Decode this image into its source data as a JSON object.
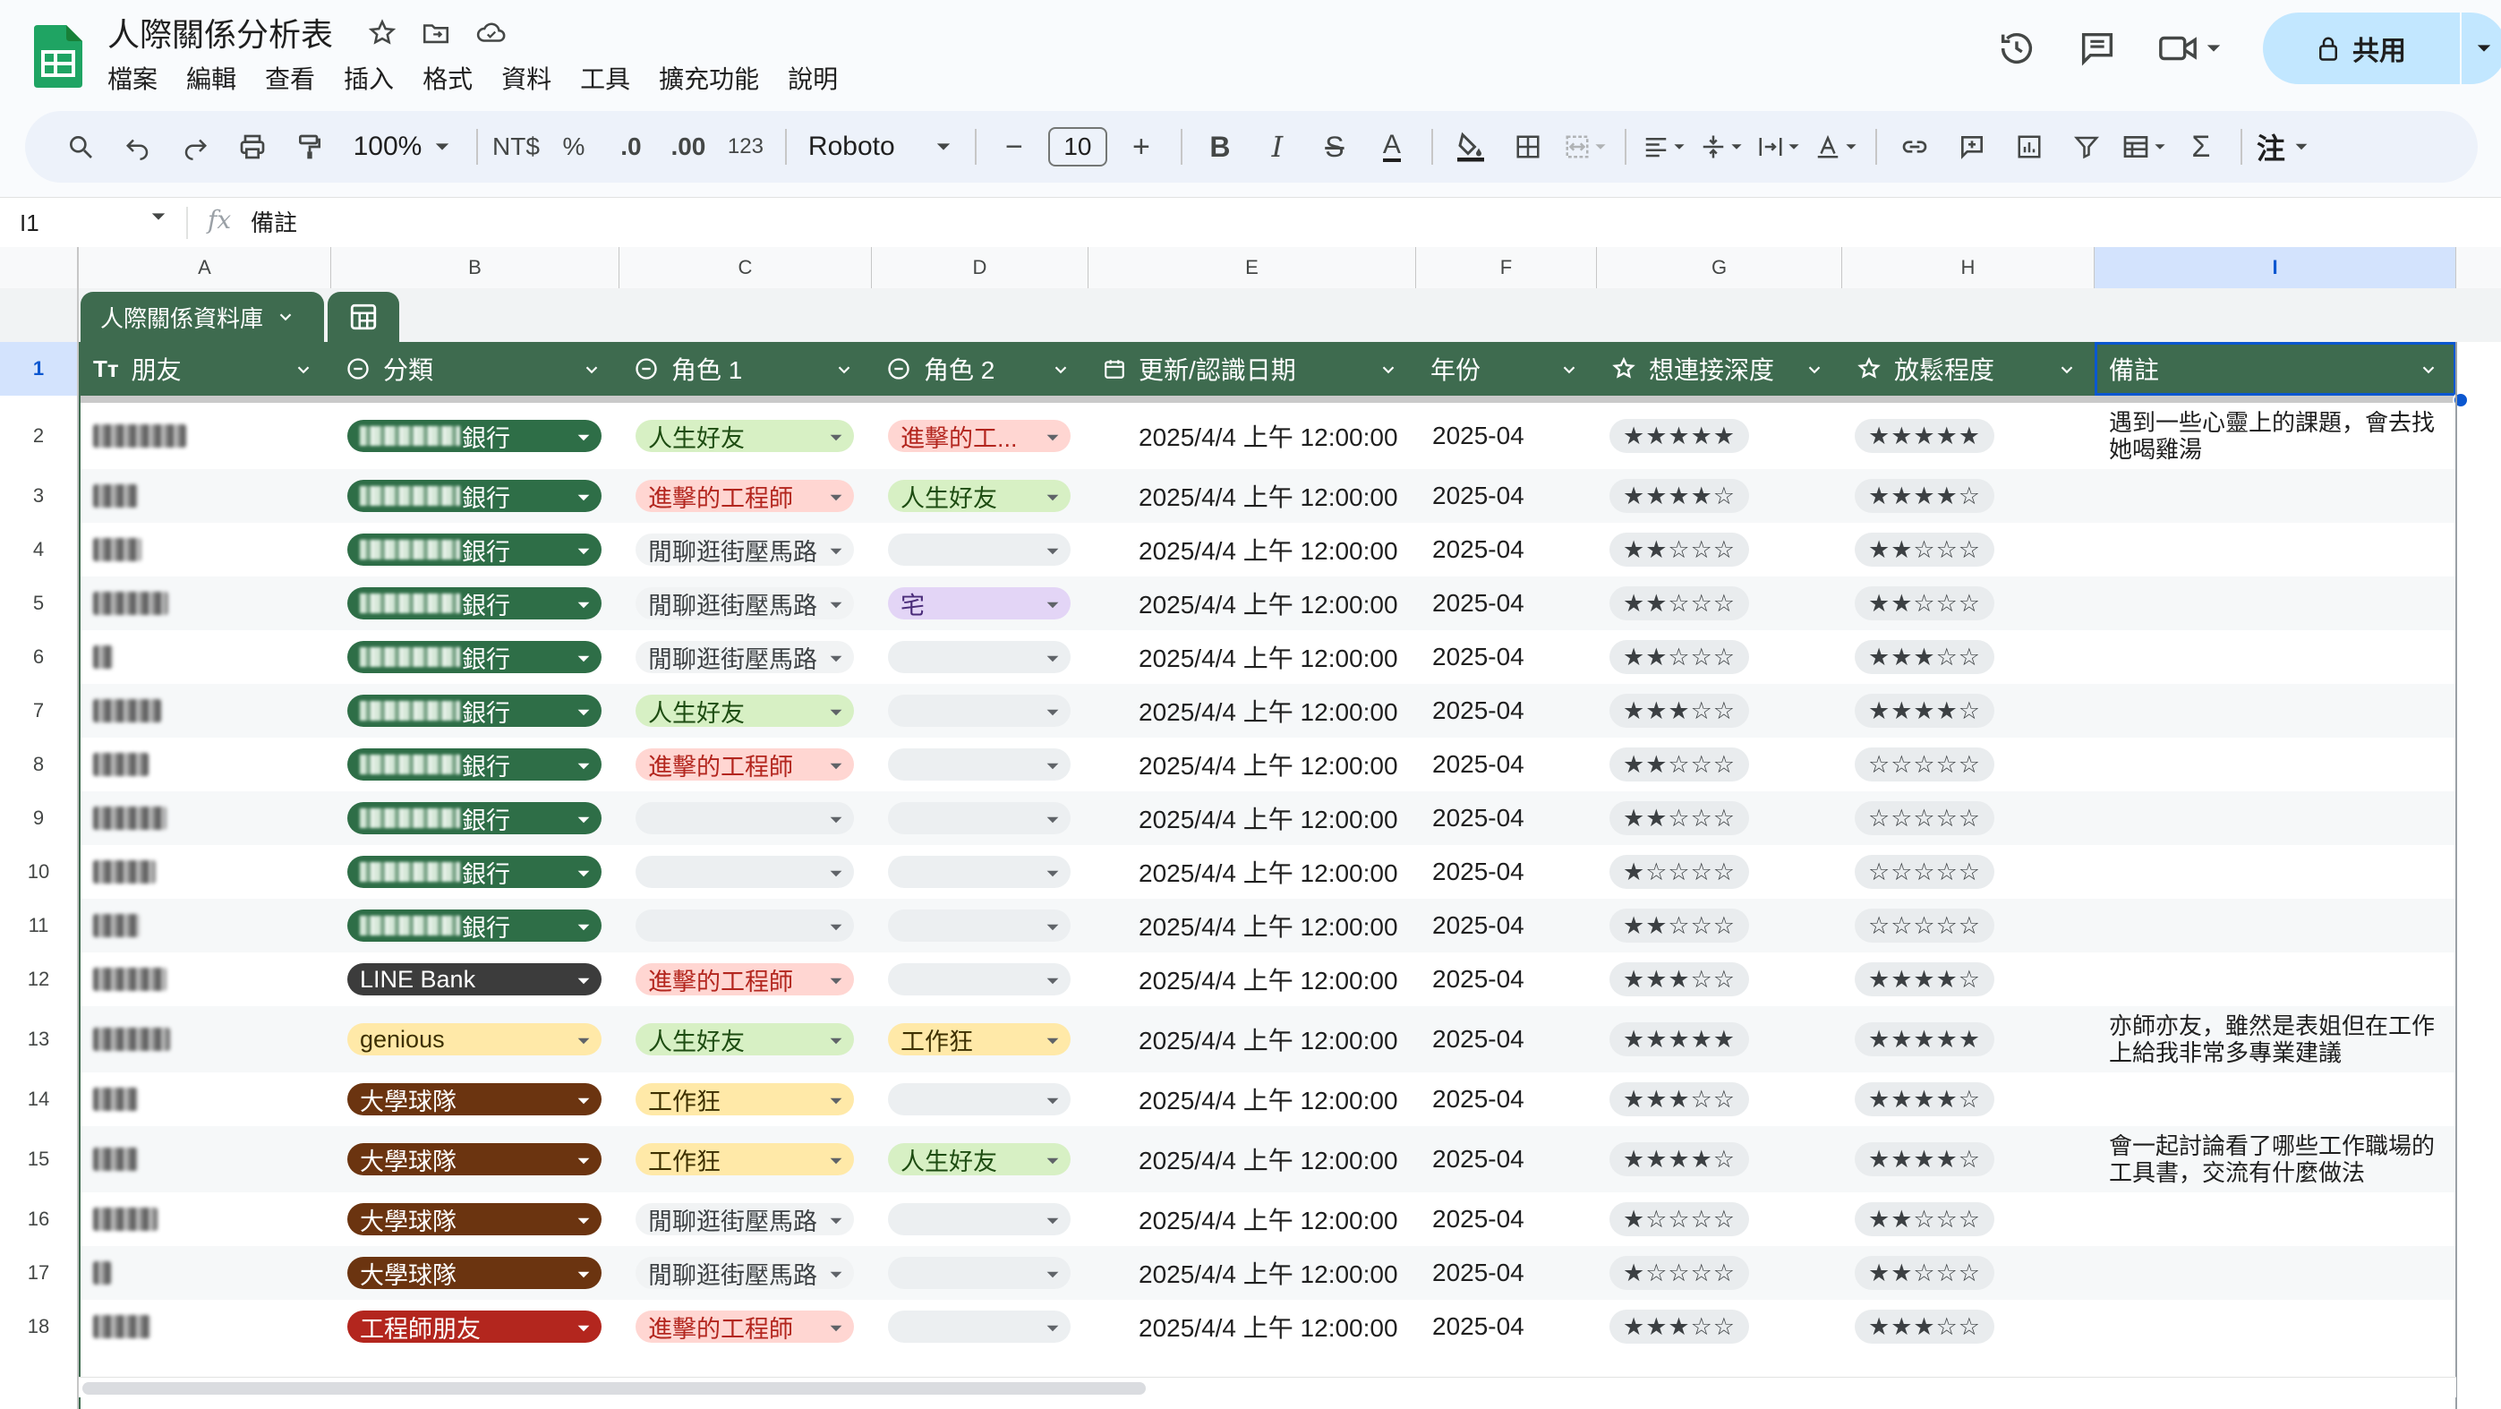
{
  "app": {
    "doc_title": "人際關係分析表",
    "menu": [
      "檔案",
      "編輯",
      "查看",
      "插入",
      "格式",
      "資料",
      "工具",
      "擴充功能",
      "說明"
    ],
    "share_label": "共用"
  },
  "toolbar": {
    "zoom": "100%",
    "currency": "NT$",
    "percent": "%",
    "dec_decrease": ".0",
    "dec_increase": ".00",
    "number_format": "123",
    "font": "Roboto",
    "font_size": "10",
    "minus": "−",
    "plus": "+",
    "bold": "B",
    "italic": "I",
    "strike": "S",
    "text_color": "A",
    "last": "注"
  },
  "formula_bar": {
    "cell_ref": "I1",
    "fx": "fx",
    "value": "備註"
  },
  "columns": [
    "A",
    "B",
    "C",
    "D",
    "E",
    "F",
    "G",
    "H",
    "I"
  ],
  "table": {
    "name": "人際關係資料庫",
    "headers": [
      "朋友",
      "分類",
      "角色 1",
      "角色 2",
      "更新/認識日期",
      "年份",
      "想連接深度",
      "放鬆程度",
      "備註"
    ],
    "header_icons": [
      "text-type-icon",
      "dropdown-chip-icon",
      "dropdown-chip-icon",
      "dropdown-chip-icon",
      "calendar-icon",
      "",
      "star-icon",
      "star-icon",
      ""
    ]
  },
  "rows": [
    {
      "n": "2",
      "cat": "銀行",
      "catColor": "green",
      "r1": "人生好友",
      "r1c": "lime",
      "r2": "進擊的工...",
      "r2c": "red",
      "date": "2025/4/4 上午 12:00:00",
      "year": "2025-04",
      "depth": "★★★★★",
      "relax": "★★★★★",
      "note": "遇到一些心靈上的課題，會去找她喝雞湯"
    },
    {
      "n": "3",
      "cat": "銀行",
      "catColor": "green",
      "r1": "進擊的工程師",
      "r1c": "red",
      "r2": "人生好友",
      "r2c": "lime",
      "date": "2025/4/4 上午 12:00:00",
      "year": "2025-04",
      "depth": "★★★★☆",
      "relax": "★★★★☆",
      "note": ""
    },
    {
      "n": "4",
      "cat": "銀行",
      "catColor": "green",
      "r1": "閒聊逛街壓馬路",
      "r1c": "gray",
      "r2": "",
      "r2c": "empty",
      "date": "2025/4/4 上午 12:00:00",
      "year": "2025-04",
      "depth": "★★☆☆☆",
      "relax": "★★☆☆☆",
      "note": ""
    },
    {
      "n": "5",
      "cat": "銀行",
      "catColor": "green",
      "r1": "閒聊逛街壓馬路",
      "r1c": "gray",
      "r2": "宅",
      "r2c": "purple",
      "date": "2025/4/4 上午 12:00:00",
      "year": "2025-04",
      "depth": "★★☆☆☆",
      "relax": "★★☆☆☆",
      "note": ""
    },
    {
      "n": "6",
      "cat": "銀行",
      "catColor": "green",
      "r1": "閒聊逛街壓馬路",
      "r1c": "gray",
      "r2": "",
      "r2c": "empty",
      "date": "2025/4/4 上午 12:00:00",
      "year": "2025-04",
      "depth": "★★☆☆☆",
      "relax": "★★★☆☆",
      "note": ""
    },
    {
      "n": "7",
      "cat": "銀行",
      "catColor": "green",
      "r1": "人生好友",
      "r1c": "lime",
      "r2": "",
      "r2c": "empty",
      "date": "2025/4/4 上午 12:00:00",
      "year": "2025-04",
      "depth": "★★★☆☆",
      "relax": "★★★★☆",
      "note": ""
    },
    {
      "n": "8",
      "cat": "銀行",
      "catColor": "green",
      "r1": "進擊的工程師",
      "r1c": "red",
      "r2": "",
      "r2c": "empty",
      "date": "2025/4/4 上午 12:00:00",
      "year": "2025-04",
      "depth": "★★☆☆☆",
      "relax": "☆☆☆☆☆",
      "note": ""
    },
    {
      "n": "9",
      "cat": "銀行",
      "catColor": "green",
      "r1": "",
      "r1c": "empty",
      "r2": "",
      "r2c": "empty",
      "date": "2025/4/4 上午 12:00:00",
      "year": "2025-04",
      "depth": "★★☆☆☆",
      "relax": "☆☆☆☆☆",
      "note": ""
    },
    {
      "n": "10",
      "cat": "銀行",
      "catColor": "green",
      "r1": "",
      "r1c": "empty",
      "r2": "",
      "r2c": "empty",
      "date": "2025/4/4 上午 12:00:00",
      "year": "2025-04",
      "depth": "★☆☆☆☆",
      "relax": "☆☆☆☆☆",
      "note": ""
    },
    {
      "n": "11",
      "cat": "銀行",
      "catColor": "green",
      "r1": "",
      "r1c": "empty",
      "r2": "",
      "r2c": "empty",
      "date": "2025/4/4 上午 12:00:00",
      "year": "2025-04",
      "depth": "★★☆☆☆",
      "relax": "☆☆☆☆☆",
      "note": ""
    },
    {
      "n": "12",
      "cat": "LINE Bank",
      "catColor": "dark",
      "r1": "進擊的工程師",
      "r1c": "red",
      "r2": "",
      "r2c": "empty",
      "date": "2025/4/4 上午 12:00:00",
      "year": "2025-04",
      "depth": "★★★☆☆",
      "relax": "★★★★☆",
      "note": ""
    },
    {
      "n": "13",
      "cat": "genious",
      "catColor": "yellow",
      "r1": "人生好友",
      "r1c": "lime",
      "r2": "工作狂",
      "r2c": "yellow",
      "date": "2025/4/4 上午 12:00:00",
      "year": "2025-04",
      "depth": "★★★★★",
      "relax": "★★★★★",
      "note": "亦師亦友，雖然是表姐但在工作上給我非常多專業建議"
    },
    {
      "n": "14",
      "cat": "大學球隊",
      "catColor": "brown",
      "r1": "工作狂",
      "r1c": "yellow",
      "r2": "",
      "r2c": "empty",
      "date": "2025/4/4 上午 12:00:00",
      "year": "2025-04",
      "depth": "★★★☆☆",
      "relax": "★★★★☆",
      "note": ""
    },
    {
      "n": "15",
      "cat": "大學球隊",
      "catColor": "brown",
      "r1": "工作狂",
      "r1c": "yellow",
      "r2": "人生好友",
      "r2c": "lime",
      "date": "2025/4/4 上午 12:00:00",
      "year": "2025-04",
      "depth": "★★★★☆",
      "relax": "★★★★☆",
      "note": "會一起討論看了哪些工作職場的工具書，交流有什麼做法"
    },
    {
      "n": "16",
      "cat": "大學球隊",
      "catColor": "brown",
      "r1": "閒聊逛街壓馬路",
      "r1c": "gray",
      "r2": "",
      "r2c": "empty",
      "date": "2025/4/4 上午 12:00:00",
      "year": "2025-04",
      "depth": "★☆☆☆☆",
      "relax": "★★☆☆☆",
      "note": ""
    },
    {
      "n": "17",
      "cat": "大學球隊",
      "catColor": "brown",
      "r1": "閒聊逛街壓馬路",
      "r1c": "gray",
      "r2": "",
      "r2c": "empty",
      "date": "2025/4/4 上午 12:00:00",
      "year": "2025-04",
      "depth": "★☆☆☆☆",
      "relax": "★★☆☆☆",
      "note": ""
    },
    {
      "n": "18",
      "cat": "工程師朋友",
      "catColor": "crimson",
      "r1": "進擊的工程師",
      "r1c": "red",
      "r2": "",
      "r2c": "empty",
      "date": "2025/4/4 上午 12:00:00",
      "year": "2025-04",
      "depth": "★★★☆☆",
      "relax": "★★★☆☆",
      "note": ""
    }
  ],
  "colors": {
    "table_header_bg": "#3e6b4f",
    "share_bg": "#c2e7ff",
    "selection": "#0b57d0",
    "chip_green": "#2e6e47",
    "chip_dark": "#3c3c3c",
    "chip_brown": "#6b3410",
    "chip_crimson": "#b3261e",
    "chip_yellow": "#ffe9a8",
    "chip_lime": "#d7f0c4",
    "chip_red": "#ffd6d2",
    "chip_purple": "#e3d5f6",
    "chip_gray": "#f1f3f4"
  }
}
